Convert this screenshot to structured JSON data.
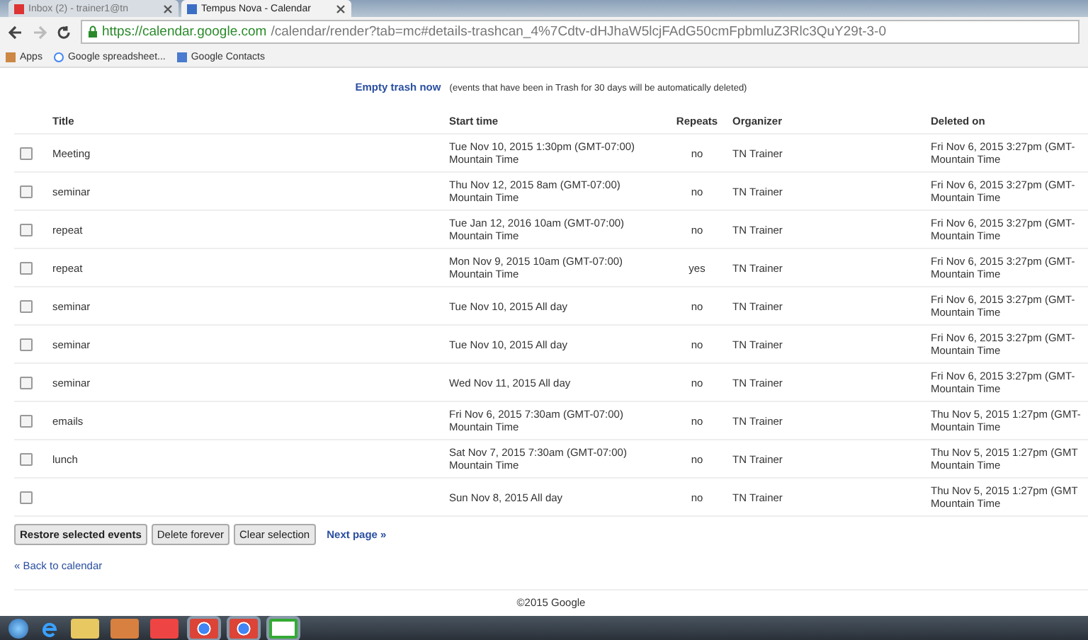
{
  "browser": {
    "tabs": [
      {
        "label": "Inbox (2) - trainer1@tn",
        "selected": false
      },
      {
        "label": "Tempus Nova - Calendar",
        "selected": true
      }
    ],
    "url_host": "https://calendar.google.com",
    "url_path": "/calendar/render?tab=mc#details-trashcan_4%7Cdtv-dHJhaW5lcjFAdG50cmFpbmluZ3Rlc3QuY29t-3-0",
    "bookmarks": [
      "Apps",
      "Google spreadsheet...",
      "Google Contacts"
    ]
  },
  "trash_bar": {
    "link": "Empty trash now",
    "note": "(events that have been in Trash for 30 days will be automatically deleted)"
  },
  "table": {
    "columns": [
      "Title",
      "Start time",
      "Repeats",
      "Organizer",
      "Deleted on"
    ],
    "rows": [
      {
        "checked": false,
        "title": "Meeting",
        "start": [
          "Tue Nov 10, 2015 1:30pm (GMT-07:00)",
          "Mountain Time"
        ],
        "repeats": "no",
        "organizer": "TN Trainer",
        "deleted": [
          "Fri Nov 6, 2015 3:27pm (GMT-",
          "Mountain Time"
        ]
      },
      {
        "checked": false,
        "title": "seminar",
        "start": [
          "Thu Nov 12, 2015 8am (GMT-07:00)",
          "Mountain Time"
        ],
        "repeats": "no",
        "organizer": "TN Trainer",
        "deleted": [
          "Fri Nov 6, 2015 3:27pm (GMT-",
          "Mountain Time"
        ]
      },
      {
        "checked": false,
        "title": "repeat",
        "start": [
          "Tue Jan 12, 2016 10am (GMT-07:00)",
          "Mountain Time"
        ],
        "repeats": "no",
        "organizer": "TN Trainer",
        "deleted": [
          "Fri Nov 6, 2015 3:27pm (GMT-",
          "Mountain Time"
        ]
      },
      {
        "checked": false,
        "title": "repeat",
        "start": [
          "Mon Nov 9, 2015 10am (GMT-07:00)",
          "Mountain Time"
        ],
        "repeats": "yes",
        "organizer": "TN Trainer",
        "deleted": [
          "Fri Nov 6, 2015 3:27pm (GMT-",
          "Mountain Time"
        ]
      },
      {
        "checked": false,
        "title": "seminar",
        "start": [
          "Tue Nov 10, 2015 All day"
        ],
        "repeats": "no",
        "organizer": "TN Trainer",
        "deleted": [
          "Fri Nov 6, 2015 3:27pm (GMT-",
          "Mountain Time"
        ]
      },
      {
        "checked": false,
        "title": "seminar",
        "start": [
          "Tue Nov 10, 2015 All day"
        ],
        "repeats": "no",
        "organizer": "TN Trainer",
        "deleted": [
          "Fri Nov 6, 2015 3:27pm (GMT-",
          "Mountain Time"
        ]
      },
      {
        "checked": false,
        "title": "seminar",
        "start": [
          "Wed Nov 11, 2015 All day"
        ],
        "repeats": "no",
        "organizer": "TN Trainer",
        "deleted": [
          "Fri Nov 6, 2015 3:27pm (GMT-",
          "Mountain Time"
        ]
      },
      {
        "checked": false,
        "title": "emails",
        "start": [
          "Fri Nov 6, 2015 7:30am (GMT-07:00)",
          "Mountain Time"
        ],
        "repeats": "no",
        "organizer": "TN Trainer",
        "deleted": [
          "Thu Nov 5, 2015 1:27pm (GMT-",
          "Mountain Time"
        ]
      },
      {
        "checked": false,
        "title": "lunch",
        "start": [
          "Sat Nov 7, 2015 7:30am (GMT-07:00)",
          "Mountain Time"
        ],
        "repeats": "no",
        "organizer": "TN Trainer",
        "deleted": [
          "Thu Nov 5, 2015 1:27pm (GMT",
          "Mountain Time"
        ]
      },
      {
        "checked": false,
        "start": [
          "Sun Nov 8, 2015 All day"
        ],
        "repeats": "no",
        "organizer": "TN Trainer",
        "deleted": [
          "Thu Nov 5, 2015 1:27pm (GMT",
          "Mountain Time"
        ]
      }
    ]
  },
  "actions": [
    "Restore selected events",
    "Delete forever",
    "Clear selection"
  ],
  "next_link": "Next page »",
  "back_link": "« Back to calendar",
  "footer": "©2015 Google"
}
